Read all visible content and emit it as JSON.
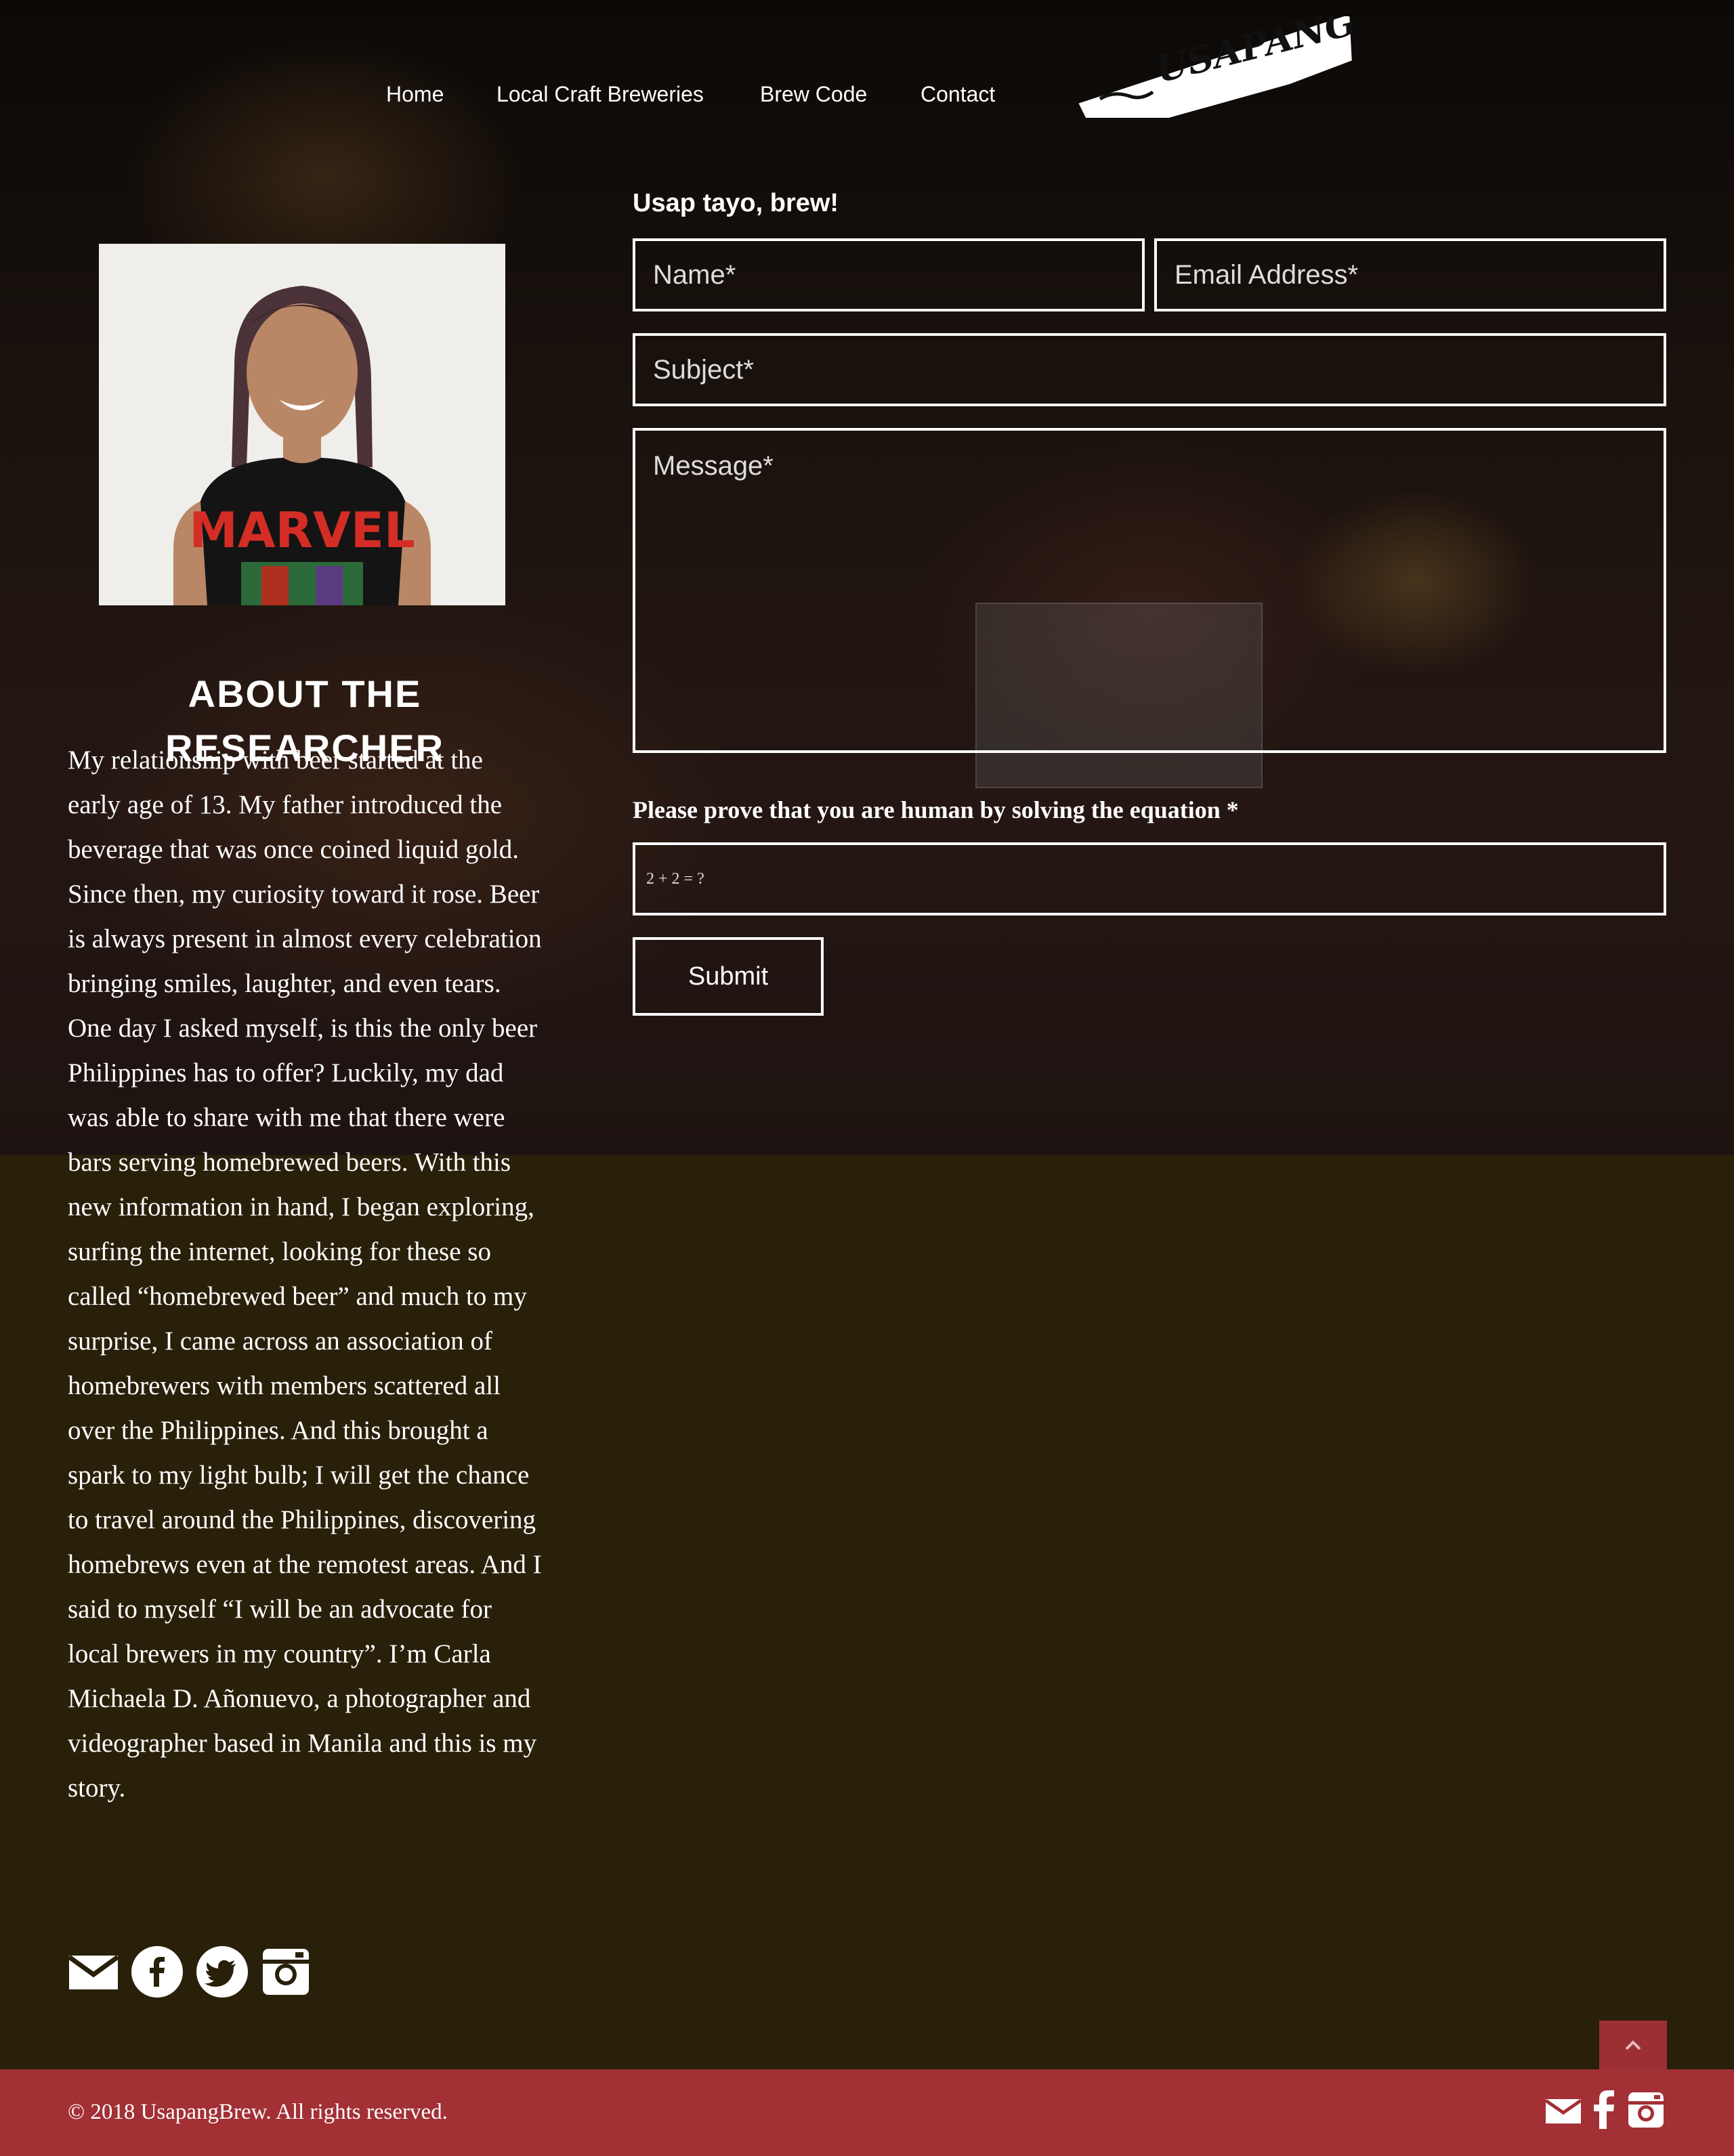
{
  "colors": {
    "footer_bg": "#a23035",
    "page_bg": "#29200a",
    "text": "#ffffff"
  },
  "nav": {
    "items": [
      {
        "label": "Home"
      },
      {
        "label": "Local Craft Breweries"
      },
      {
        "label": "Brew Code"
      },
      {
        "label": "Contact"
      }
    ],
    "logo_text": "USAPANG BREW"
  },
  "about": {
    "title": "ABOUT THE RESEARCHER",
    "portrait_shirt_text": "MARVEL",
    "body": "My relationship with beer started at the early age of 13. My father introduced the beverage that was once coined liquid gold. Since then, my curiosity toward it rose. Beer is always present in almost every celebration bringing smiles, laughter, and even tears. One day I asked myself, is this the only beer Philippines has to offer? Luckily, my dad was able to share with me that there were bars serving homebrewed beers. With this new information in hand, I began exploring, surfing the internet, looking for these so called “homebrewed beer” and much to my surprise, I came across an association of homebrewers with members scattered all over the Philippines. And this brought a spark to my light bulb; I will get the chance to travel around the Philippines, discovering homebrews even at the remotest areas. And I said to myself “I will be an advocate for local brewers in my country”. I’m Carla Michaela D. Añonuevo, a photographer and videographer based in Manila and this is my story."
  },
  "form": {
    "heading": "Usap tayo, brew!",
    "name_placeholder": "Name*",
    "email_placeholder": "Email Address*",
    "subject_placeholder": "Subject*",
    "message_placeholder": "Message*",
    "captcha_label": "Please prove that you are human by solving the equation *",
    "captcha_placeholder": "2 + 2 = ?",
    "submit_label": "Submit"
  },
  "social": {
    "icons": [
      "mail-icon",
      "facebook-icon",
      "twitter-icon",
      "instagram-icon"
    ]
  },
  "footer": {
    "copyright": "© 2018 UsapangBrew. All rights reserved.",
    "icons": [
      "mail-icon",
      "facebook-icon",
      "instagram-icon"
    ]
  },
  "scroll_top": {
    "icon": "chevron-up-icon"
  }
}
